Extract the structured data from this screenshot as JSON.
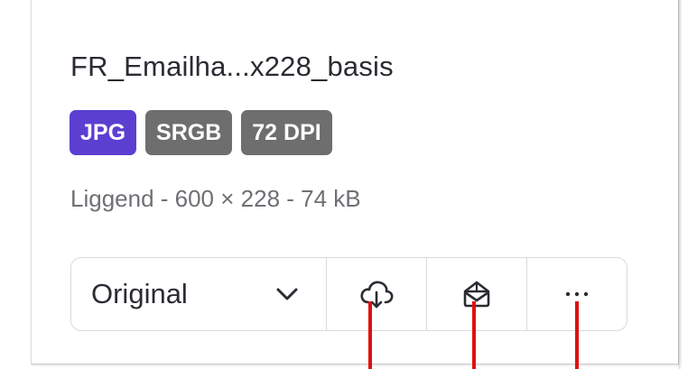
{
  "asset": {
    "title": "FR_Emailha...x228_basis",
    "badges": [
      {
        "label": "JPG",
        "color": "#5b3fd1"
      },
      {
        "label": "SRGB",
        "color": "#6e6e6e"
      },
      {
        "label": "72 DPI",
        "color": "#6e6e6e"
      }
    ],
    "meta": "Liggend - 600 × 228 - 74 kB"
  },
  "toolbar": {
    "format_select": {
      "value": "Original",
      "icon": "chevron-down-icon"
    },
    "download_icon": "cloud-download-icon",
    "share_icon": "mailbox-icon",
    "more_icon": "more-horizontal-icon"
  },
  "annotations": {
    "marker_color": "#e01010"
  }
}
